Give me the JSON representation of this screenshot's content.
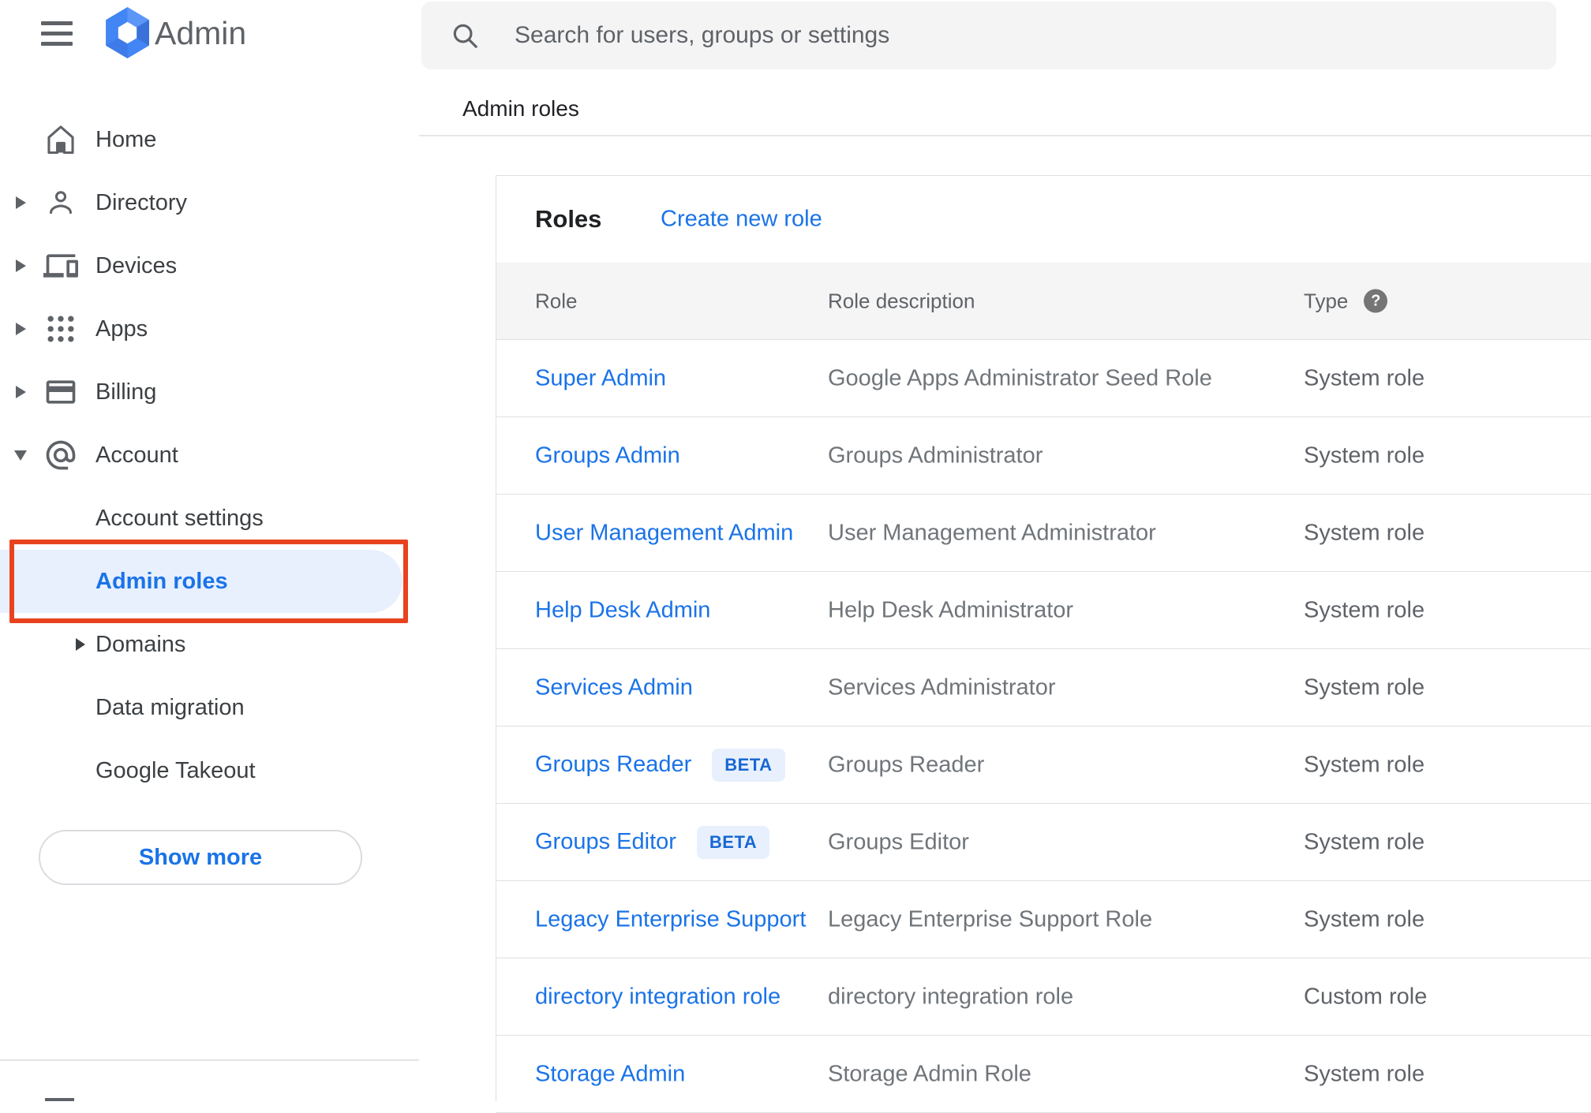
{
  "app": {
    "brand": "Admin"
  },
  "search": {
    "placeholder": "Search for users, groups or settings"
  },
  "breadcrumb": "Admin roles",
  "sidebar": {
    "items": [
      {
        "label": "Home"
      },
      {
        "label": "Directory"
      },
      {
        "label": "Devices"
      },
      {
        "label": "Apps"
      },
      {
        "label": "Billing"
      },
      {
        "label": "Account"
      }
    ],
    "account_children": [
      {
        "label": "Account settings"
      },
      {
        "label": "Admin roles"
      },
      {
        "label": "Domains"
      },
      {
        "label": "Data migration"
      },
      {
        "label": "Google Takeout"
      }
    ],
    "show_more_label": "Show more"
  },
  "roles_card": {
    "title": "Roles",
    "create_link": "Create new role",
    "columns": {
      "role": "Role",
      "description": "Role description",
      "type": "Type"
    },
    "help_glyph": "?",
    "beta_label": "BETA",
    "rows": [
      {
        "role": "Super Admin",
        "description": "Google Apps Administrator Seed Role",
        "type": "System role",
        "beta": false
      },
      {
        "role": "Groups Admin",
        "description": "Groups Administrator",
        "type": "System role",
        "beta": false
      },
      {
        "role": "User Management Admin",
        "description": "User Management Administrator",
        "type": "System role",
        "beta": false
      },
      {
        "role": "Help Desk Admin",
        "description": "Help Desk Administrator",
        "type": "System role",
        "beta": false
      },
      {
        "role": "Services Admin",
        "description": "Services Administrator",
        "type": "System role",
        "beta": false
      },
      {
        "role": "Groups Reader",
        "description": "Groups Reader",
        "type": "System role",
        "beta": true
      },
      {
        "role": "Groups Editor",
        "description": "Groups Editor",
        "type": "System role",
        "beta": true
      },
      {
        "role": "Legacy Enterprise Support",
        "description": "Legacy Enterprise Support Role",
        "type": "System role",
        "beta": false
      },
      {
        "role": "directory integration role",
        "description": "directory integration role",
        "type": "Custom role",
        "beta": false
      },
      {
        "role": "Storage Admin",
        "description": "Storage Admin Role",
        "type": "System role",
        "beta": false
      }
    ]
  },
  "colors": {
    "link_blue": "#1a73e8",
    "active_item_bg": "#e8f0fe",
    "annotation_red": "#e8431f",
    "beta_text": "#1967d2",
    "table_header_bg": "#f5f5f5",
    "logo_blue": "#4285f4"
  }
}
